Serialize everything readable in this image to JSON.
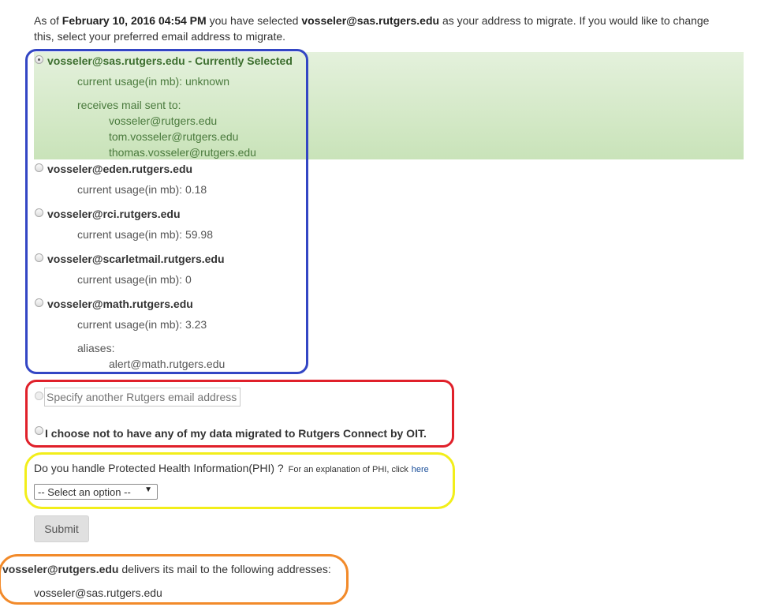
{
  "intro": {
    "prefix": "As of ",
    "datetime": "February 10, 2016 04:54 PM",
    "middle": " you have selected ",
    "address": "vosseler@sas.rutgers.edu",
    "suffix_line1": " as your address to migrate. If you would like to change",
    "line2": "this, select your preferred email address to migrate."
  },
  "accounts": [
    {
      "address": "vosseler@sas.rutgers.edu",
      "current_label": " - Currently Selected",
      "usage": "current usage(in mb): unknown",
      "receives_label": "receives mail sent to:",
      "receives": [
        "vosseler@rutgers.edu",
        "tom.vosseler@rutgers.edu",
        "thomas.vosseler@rutgers.edu"
      ]
    },
    {
      "address": "vosseler@eden.rutgers.edu",
      "usage": "current usage(in mb): 0.18"
    },
    {
      "address": "vosseler@rci.rutgers.edu",
      "usage": "current usage(in mb): 59.98"
    },
    {
      "address": "vosseler@scarletmail.rutgers.edu",
      "usage": "current usage(in mb): 0"
    },
    {
      "address": "vosseler@math.rutgers.edu",
      "usage": "current usage(in mb): 3.23",
      "aliases_label": "aliases:",
      "aliases": [
        "alert@math.rutgers.edu"
      ]
    }
  ],
  "other": {
    "specify_placeholder": "Specify another Rutgers email address",
    "optout_label": "I choose not to have any of my data migrated to Rutgers Connect by OIT."
  },
  "phi": {
    "question": "Do you handle Protected Health Information(PHI) ?",
    "explanation": "For an explanation of PHI, click",
    "link": "here",
    "select_value": "-- Select an option --"
  },
  "submit_label": "Submit",
  "delivery": {
    "address": "vosseler@rutgers.edu",
    "text": " delivers its mail to the following addresses:",
    "targets": [
      "vosseler@sas.rutgers.edu"
    ]
  },
  "colors": {
    "selected_bg": "#dcedd3",
    "annotation_blue": "#3346c4",
    "annotation_red": "#e0202a",
    "annotation_yellow": "#f2ee1a",
    "annotation_orange": "#f28a2a"
  }
}
